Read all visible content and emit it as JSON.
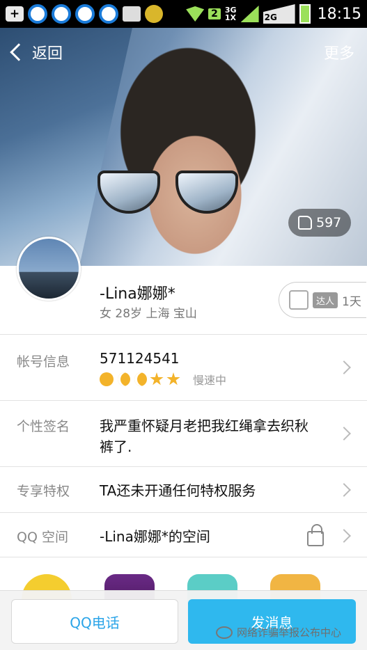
{
  "status_bar": {
    "icons": [
      "plus-icon",
      "qq-icon",
      "qq-icon",
      "qq-icon",
      "qq-icon",
      "image-icon",
      "coin-icon",
      "wifi-icon",
      "sim-icon",
      "signal-icon",
      "battery-icon"
    ],
    "sim_slot": "2",
    "network_top": "3G",
    "network_bottom": "1X",
    "network2": "2G",
    "time": "18:15"
  },
  "nav": {
    "back_label": "返回",
    "more_label": "更多"
  },
  "cover": {
    "likes": "597"
  },
  "profile": {
    "nickname": "-Lina娜娜*",
    "meta": "女  28岁  上海  宝山",
    "badge_label": "达人",
    "badge_days": "1天"
  },
  "rows": {
    "account": {
      "label": "帐号信息",
      "value": "571124541",
      "level_icons": [
        "sun-icon",
        "moon-icon",
        "moon-icon",
        "star-icon",
        "star-icon"
      ],
      "speed": "慢速中"
    },
    "signature": {
      "label": "个性签名",
      "line1": "我严重怀疑月老把我红绳拿去织秋",
      "line2": "裤了."
    },
    "privilege": {
      "label": "专享特权",
      "value": "TA还未开通任何特权服务"
    },
    "qzone": {
      "label": "QQ 空间",
      "value": "-Lina娜娜*的空间"
    }
  },
  "bottom": {
    "call_label": "QQ电话",
    "message_label": "发消息",
    "watermark": "网络诈骗举报公布中心"
  }
}
